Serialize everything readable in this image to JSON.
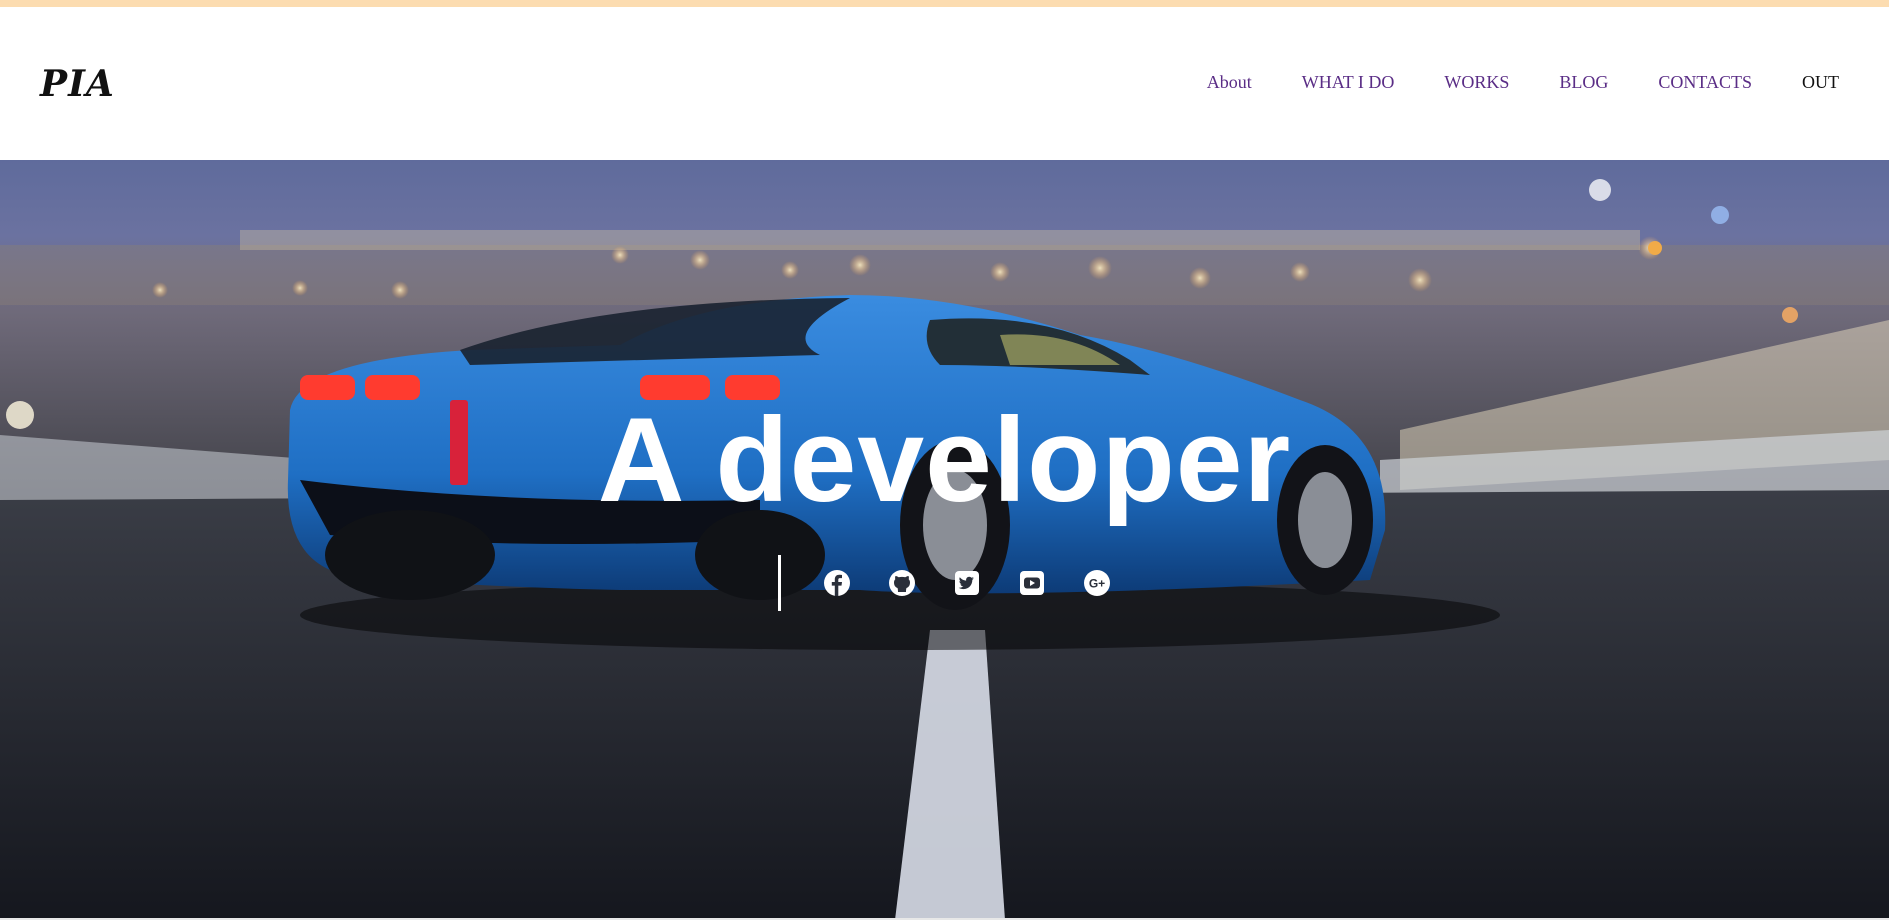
{
  "header": {
    "logo": "PIA",
    "nav": [
      {
        "label": "About"
      },
      {
        "label": "WHAT I DO"
      },
      {
        "label": "WORKS"
      },
      {
        "label": "BLOG"
      },
      {
        "label": "CONTACTS"
      },
      {
        "label": "OUT"
      }
    ]
  },
  "hero": {
    "title": "A developer",
    "social_icons": [
      "facebook-icon",
      "github-icon",
      "twitter-icon",
      "youtube-icon",
      "google-plus-icon"
    ]
  },
  "colors": {
    "nav_link": "#5a2d86",
    "top_strip": "#fcdcb0",
    "car_body": "#1f6fc4"
  }
}
